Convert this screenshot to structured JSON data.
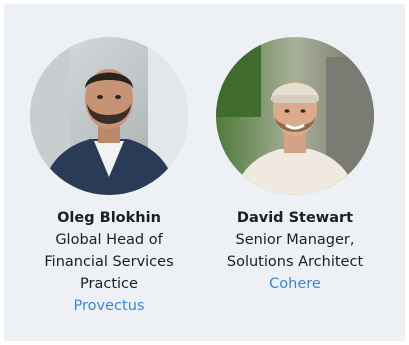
{
  "speakers": [
    {
      "name": "Oleg Blokhin",
      "title_lines": [
        "Global Head of",
        "Financial Services",
        "Practice"
      ],
      "company": "Provectus"
    },
    {
      "name": "David Stewart",
      "title_lines": [
        "Senior Manager,",
        "Solutions Architect"
      ],
      "company": "Cohere"
    }
  ],
  "colors": {
    "card_background": "#edf1f5",
    "link": "#3d86d1",
    "text": "#1b1e22"
  }
}
